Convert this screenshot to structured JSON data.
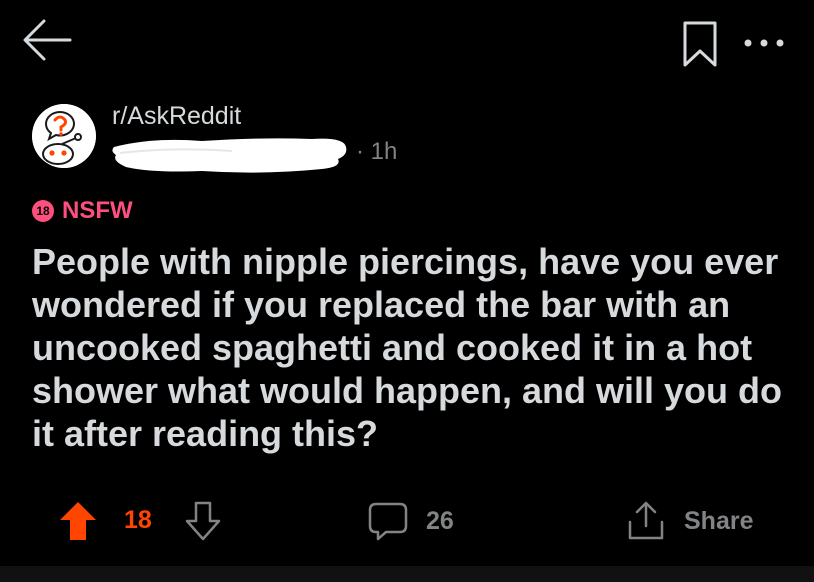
{
  "topbar": {
    "back_icon": "arrow-left-icon",
    "bookmark_icon": "bookmark-icon",
    "more_icon": "more-horizontal-icon"
  },
  "post": {
    "subreddit": "r/AskReddit",
    "time_ago": "· 1h",
    "nsfw_badge": "18",
    "nsfw_label": "NSFW",
    "title": "People with nipple piercings, have you ever wondered if you replaced the bar with an uncooked spaghetti and cooked it in a hot shower what would happen, and will you do it after reading this?"
  },
  "actions": {
    "vote_count": "18",
    "comment_count": "26",
    "share_label": "Share"
  },
  "colors": {
    "background": "#000000",
    "text": "#d7dadc",
    "muted": "#818384",
    "upvote": "#ff4500",
    "nsfw": "#ff4f7f"
  }
}
